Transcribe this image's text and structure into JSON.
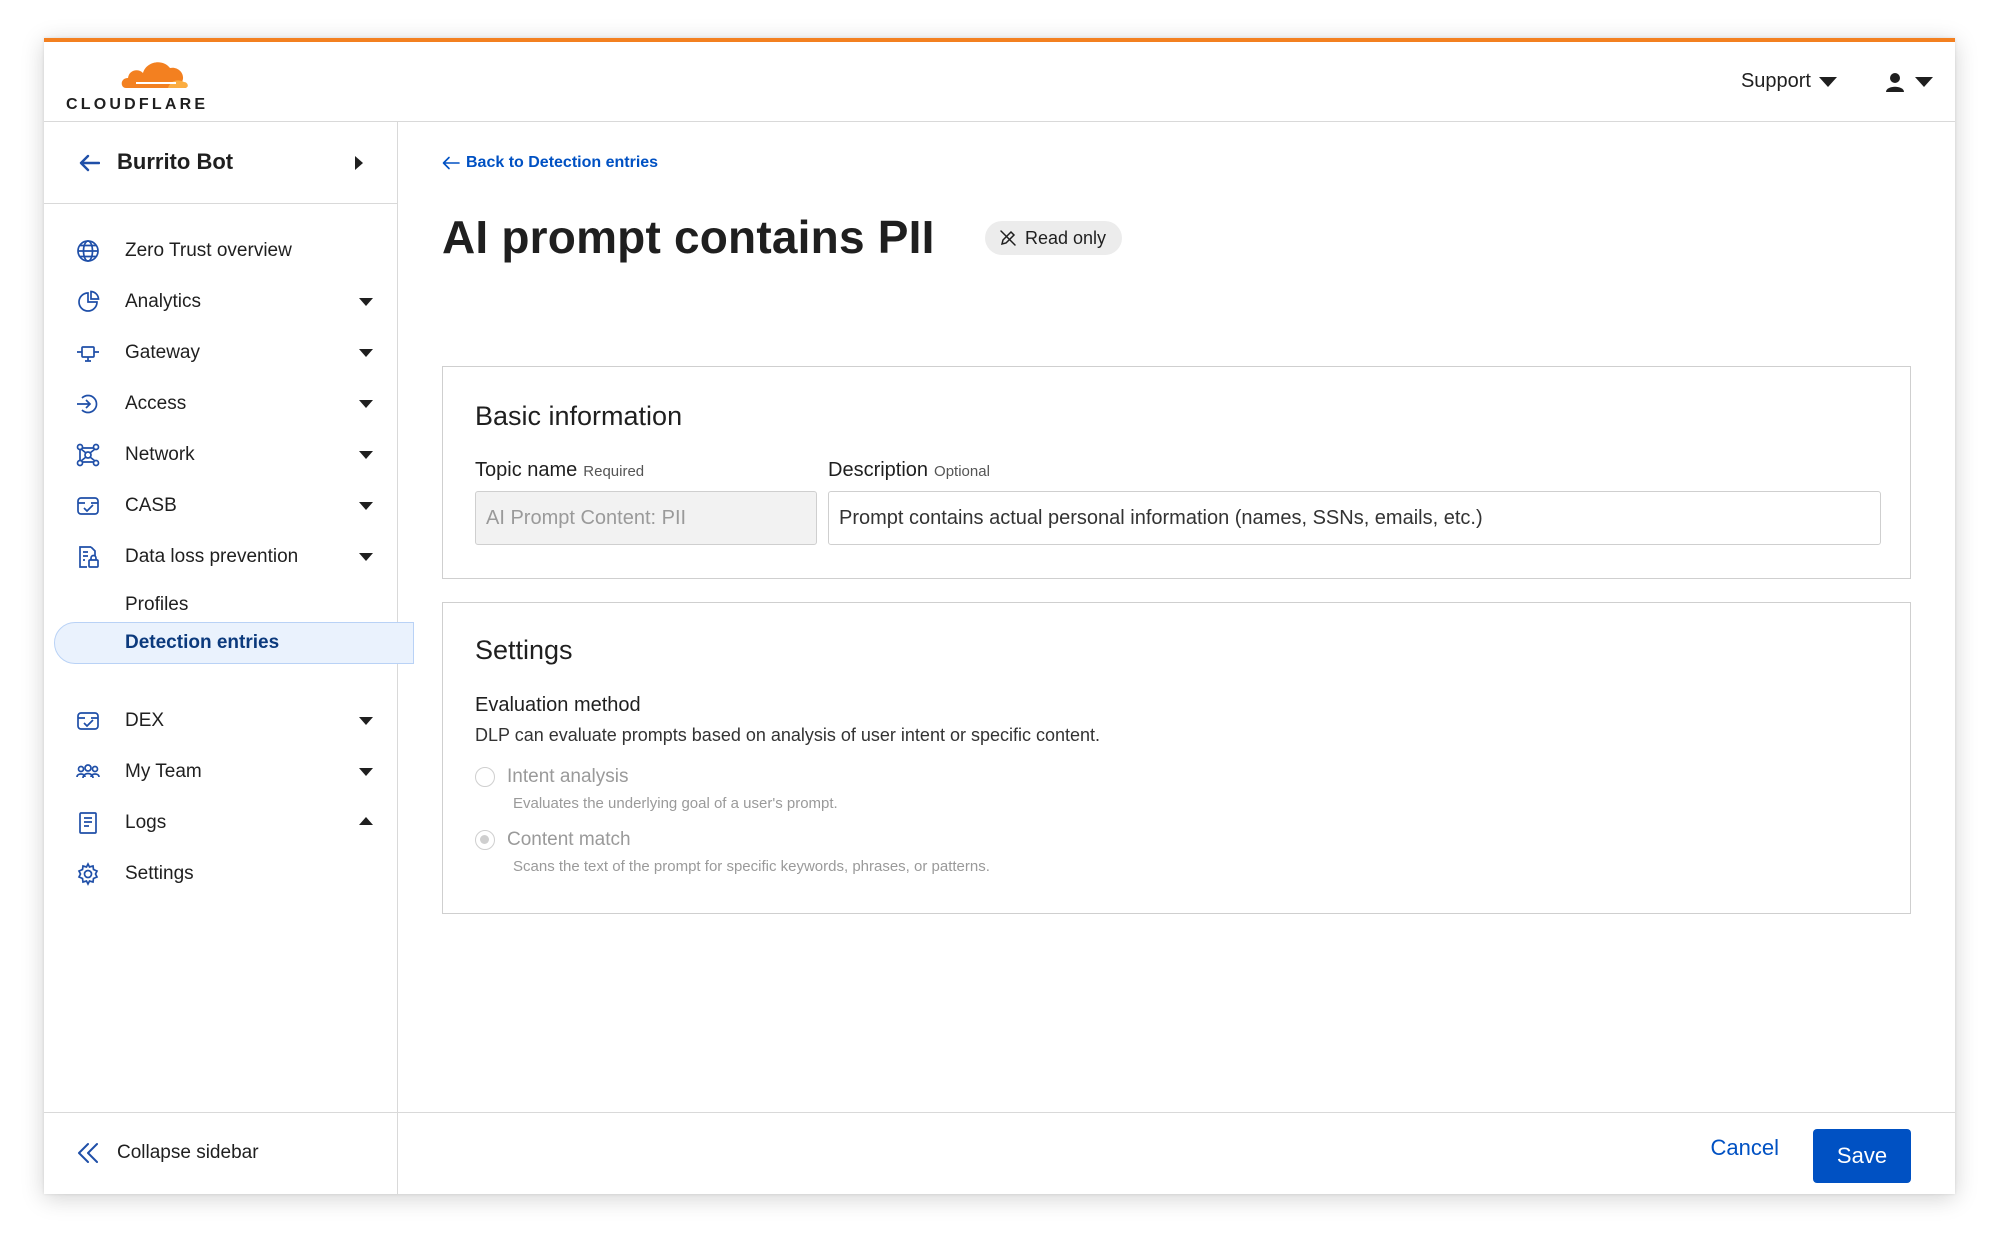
{
  "brand": {
    "name": "CLOUDFLARE",
    "accent_color": "#f38020",
    "link_color": "#0051c3",
    "logo_icon": "cloud-logo-icon"
  },
  "header": {
    "support_label": "Support",
    "user_icon": "user-icon"
  },
  "account": {
    "name": "Burrito Bot"
  },
  "sidebar": {
    "items": [
      {
        "label": "Zero Trust overview",
        "icon": "globe-icon"
      },
      {
        "label": "Analytics",
        "icon": "chart-pie-icon"
      },
      {
        "label": "Gateway",
        "icon": "gateway-icon"
      },
      {
        "label": "Access",
        "icon": "access-icon"
      },
      {
        "label": "Network",
        "icon": "network-icon"
      },
      {
        "label": "CASB",
        "icon": "casb-icon"
      },
      {
        "label": "Data loss prevention",
        "icon": "dlp-icon"
      },
      {
        "label": "DEX",
        "icon": "dex-icon"
      },
      {
        "label": "My Team",
        "icon": "team-icon"
      },
      {
        "label": "Logs",
        "icon": "logs-icon"
      },
      {
        "label": "Settings",
        "icon": "gear-icon"
      }
    ],
    "dlp_subitems": [
      {
        "label": "Profiles"
      },
      {
        "label": "Detection entries",
        "active": true
      }
    ],
    "collapse_label": "Collapse sidebar"
  },
  "page": {
    "back_label": "Back to Detection entries",
    "title": "AI prompt contains PII",
    "badge": "Read only"
  },
  "basic_info": {
    "heading": "Basic information",
    "topic_label": "Topic name",
    "topic_hint": "Required",
    "topic_value": "AI Prompt Content: PII",
    "desc_label": "Description",
    "desc_hint": "Optional",
    "desc_value": "Prompt contains actual personal information (names, SSNs, emails, etc.)"
  },
  "settings": {
    "heading": "Settings",
    "eval_label": "Evaluation method",
    "eval_desc": "DLP can evaluate prompts based on analysis of user intent or specific content.",
    "options": [
      {
        "label": "Intent analysis",
        "desc": "Evaluates the underlying goal of a user's prompt.",
        "checked": false
      },
      {
        "label": "Content match",
        "desc": "Scans the text of the prompt for specific keywords, phrases, or patterns.",
        "checked": true
      }
    ]
  },
  "footer": {
    "cancel_label": "Cancel",
    "save_label": "Save"
  }
}
